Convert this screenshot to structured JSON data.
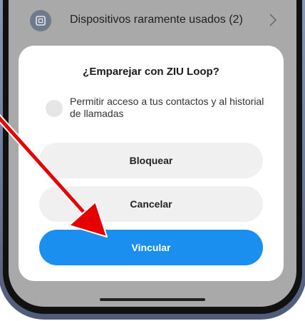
{
  "device_row": {
    "label": "Dispositivos raramente usados (2)",
    "icon": "device-box-icon"
  },
  "dialog": {
    "title": "¿Emparejar con  ZIU Loop?",
    "checkbox_label": "Permitir acceso a tus contactos y al historial de llamadas",
    "buttons": {
      "block": "Bloquear",
      "cancel": "Cancelar",
      "link": "Vincular"
    }
  },
  "colors": {
    "primary_button": "#1b8ff0",
    "secondary_button": "#f0f0f0",
    "arrow": "#e60000",
    "screen_dim": "#a9a9a9"
  }
}
